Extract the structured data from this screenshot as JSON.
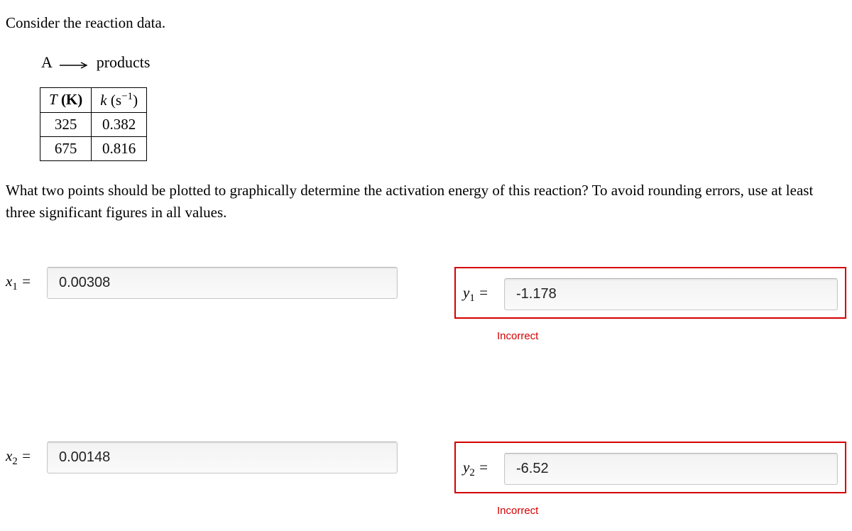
{
  "intro": "Consider the reaction data.",
  "reaction": {
    "lhs": "A",
    "rhs": "products"
  },
  "table": {
    "headers": {
      "col1_a": "T",
      "col1_b": " (K)",
      "col2_a": "k",
      "col2_b": "  (s",
      "col2_c": "−1",
      "col2_d": ")"
    },
    "rows": [
      {
        "t": "325",
        "k": "0.382"
      },
      {
        "t": "675",
        "k": "0.816"
      }
    ]
  },
  "question": "What two points should be plotted to graphically determine the activation energy of this reaction? To avoid rounding errors, use at least three significant figures in all values.",
  "answers": {
    "x1": {
      "label_var": "x",
      "label_sub": "1",
      "label_eq": " =",
      "value": "0.00308"
    },
    "y1": {
      "label_var": "y",
      "label_sub": "1",
      "label_eq": " =",
      "value": "-1.178",
      "feedback": "Incorrect"
    },
    "x2": {
      "label_var": "x",
      "label_sub": "2",
      "label_eq": " =",
      "value": "0.00148"
    },
    "y2": {
      "label_var": "y",
      "label_sub": "2",
      "label_eq": " =",
      "value": "-6.52",
      "feedback": "Incorrect"
    }
  }
}
